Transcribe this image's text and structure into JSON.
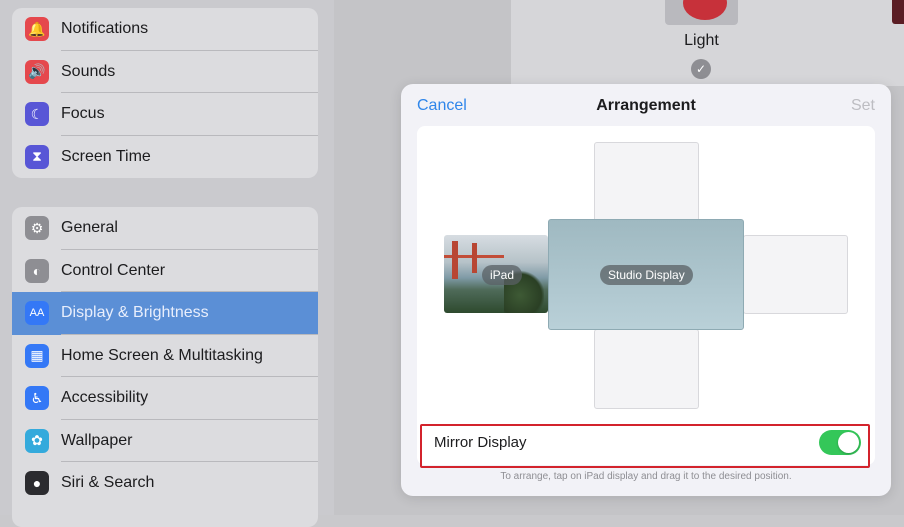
{
  "sidebar": {
    "group1": [
      {
        "label": "Notifications",
        "icon": "bell-icon",
        "color": "#e5484d",
        "glyph": "🔔"
      },
      {
        "label": "Sounds",
        "icon": "speaker-icon",
        "color": "#e5484d",
        "glyph": "🔊"
      },
      {
        "label": "Focus",
        "icon": "moon-icon",
        "color": "#5856d6",
        "glyph": "☾"
      },
      {
        "label": "Screen Time",
        "icon": "hourglass-icon",
        "color": "#5856d6",
        "glyph": "⧗"
      }
    ],
    "group2": [
      {
        "label": "General",
        "icon": "gear-icon",
        "color": "#8e8e93",
        "glyph": "⚙"
      },
      {
        "label": "Control Center",
        "icon": "toggles-icon",
        "color": "#8e8e93",
        "glyph": "◐"
      },
      {
        "label": "Display & Brightness",
        "icon": "text-size-icon",
        "color": "#3478f6",
        "glyph": "AA",
        "selected": true
      },
      {
        "label": "Home Screen & Multitasking",
        "icon": "grid-icon",
        "color": "#3478f6",
        "glyph": "▦"
      },
      {
        "label": "Accessibility",
        "icon": "accessibility-icon",
        "color": "#3478f6",
        "glyph": "♿"
      },
      {
        "label": "Wallpaper",
        "icon": "flower-icon",
        "color": "#34aadc",
        "glyph": "✿"
      },
      {
        "label": "Siri & Search",
        "icon": "siri-icon",
        "color": "#2b2b2f",
        "glyph": "●"
      }
    ]
  },
  "appearance": {
    "light_label": "Light"
  },
  "modal": {
    "cancel": "Cancel",
    "title": "Arrangement",
    "set": "Set",
    "ipad_label": "iPad",
    "studio_label": "Studio Display",
    "mirror_label": "Mirror Display",
    "mirror_on": true,
    "hint": "To arrange, tap on iPad display and drag it to the desired position."
  },
  "colors": {
    "accent": "#2f86ea",
    "toggle_on": "#34c759",
    "highlight": "#d3232c"
  }
}
